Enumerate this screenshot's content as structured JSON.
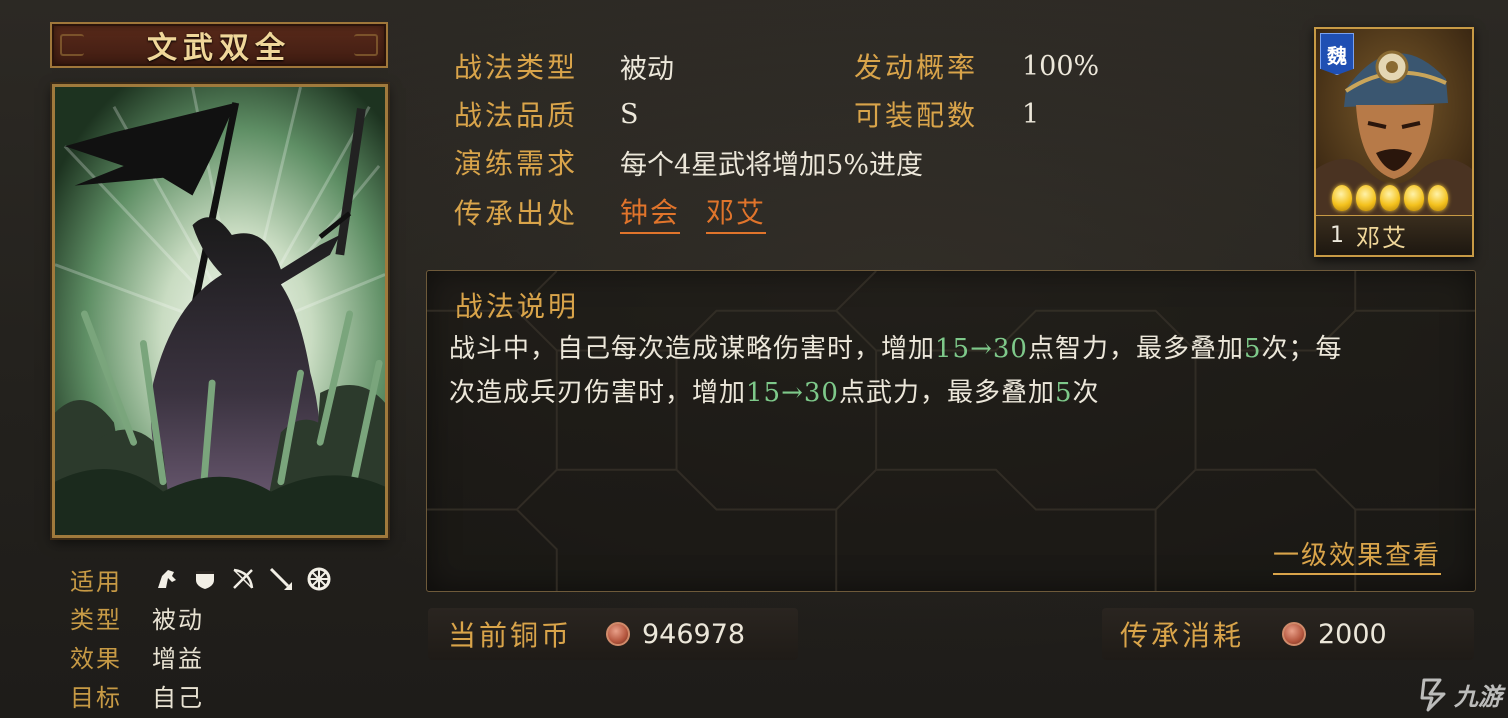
{
  "skill": {
    "name": "文武双全",
    "attributes": {
      "applicable_label": "适用",
      "troop_icons": [
        "cavalry-icon",
        "shield-icon",
        "archer-icon",
        "spear-icon",
        "siege-wheel-icon"
      ],
      "type_label": "类型",
      "type_value": "被动",
      "effect_label": "效果",
      "effect_value": "增益",
      "target_label": "目标",
      "target_value": "自己"
    }
  },
  "info": {
    "type_label": "战法类型",
    "type_value": "被动",
    "rate_label": "发动概率",
    "rate_value": "100%",
    "quality_label": "战法品质",
    "quality_value": "S",
    "slots_label": "可装配数",
    "slots_value": "1",
    "training_label": "演练需求",
    "training_value": "每个4星武将增加5%进度",
    "source_label": "传承出处",
    "sources": [
      "钟会",
      "邓艾"
    ]
  },
  "general": {
    "faction": "魏",
    "stars": 5,
    "level": "1",
    "name": "邓艾"
  },
  "description": {
    "title": "战法说明",
    "line1_a": "战斗中，自己每次造成谋略伤害时，增加",
    "line1_b": "15→30",
    "line1_c": "点智力，最多叠加",
    "line1_d": "5",
    "line1_e": "次；每",
    "line2_a": "次造成兵刃伤害时，增加",
    "line2_b": "15→30",
    "line2_c": "点武力，最多叠加",
    "line2_d": "5",
    "line2_e": "次",
    "level_link": "一级效果查看"
  },
  "currency": {
    "copper_label": "当前铜币",
    "copper_value": "946978",
    "cost_label": "传承消耗",
    "cost_value": "2000"
  },
  "watermark": "九游",
  "colors": {
    "gold_label": "#d9a44a",
    "link_orange": "#e0742b",
    "highlight_green": "#7ec98a",
    "faction_blue": "#1f4fb3"
  }
}
